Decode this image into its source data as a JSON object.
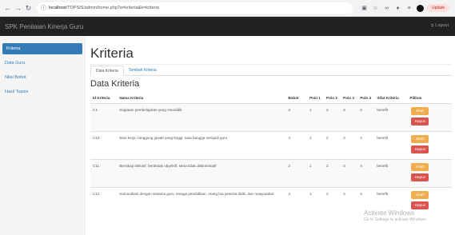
{
  "browser": {
    "url_host": "localhost",
    "url_path": "/TOPSIS/admin/home.php?a=kriteria&k=kriteria",
    "update_label": "Update"
  },
  "navbar": {
    "brand": "SPK Penilaian Kinerja Guru",
    "logout": "Logout"
  },
  "sidebar": {
    "items": [
      {
        "label": "Kriteria",
        "active": true
      },
      {
        "label": "Data Guru"
      },
      {
        "label": "Nilai Bobot"
      },
      {
        "label": "Hasil Topsis"
      }
    ]
  },
  "main": {
    "title": "Kriteria",
    "tabs": [
      {
        "label": "Data Kriteria"
      },
      {
        "label": "Tambah Kriteria"
      }
    ],
    "section_title": "Data Kriteria"
  },
  "table": {
    "headers": [
      "Id Kriteria",
      "Nama Kriteria",
      "Bobot",
      "Poin 1",
      "Poin 2",
      "Poin 3",
      "Poin 4",
      "Sifat Kriteria",
      "Pilihan"
    ],
    "rows": [
      {
        "id": "C1",
        "nama": "Kegiatan pembelajaran yang mendidik",
        "bobot": "3",
        "p1": "1",
        "p2": "2",
        "p3": "3",
        "p4": "4",
        "sifat": "benefit"
      },
      {
        "id": "C10",
        "nama": "Etos kerja, tanggung jawab yang tinggi, rasa bangga menjadi guru",
        "bobot": "4",
        "p1": "1",
        "p2": "2",
        "p3": "3",
        "p4": "4",
        "sifat": "benefit"
      },
      {
        "id": "C11",
        "nama": "Bersikap inklusif, bertindak obyektif, serta tidak diskriminatif",
        "bobot": "2",
        "p1": "1",
        "p2": "2",
        "p3": "3",
        "p4": "4",
        "sifat": "benefit"
      },
      {
        "id": "C12",
        "nama": "Komunikasi dengan sesama guru, tenaga pendidikan, orang tua peserta didik, dan masyarakat",
        "bobot": "3",
        "p1": "1",
        "p2": "2",
        "p3": "3",
        "p4": "4",
        "sifat": "benefit"
      }
    ],
    "ubah_label": "Ubah",
    "hapus_label": "Hapus"
  },
  "watermark": {
    "title": "Activate Windows",
    "subtitle": "Go to Settings to activate Windows."
  }
}
